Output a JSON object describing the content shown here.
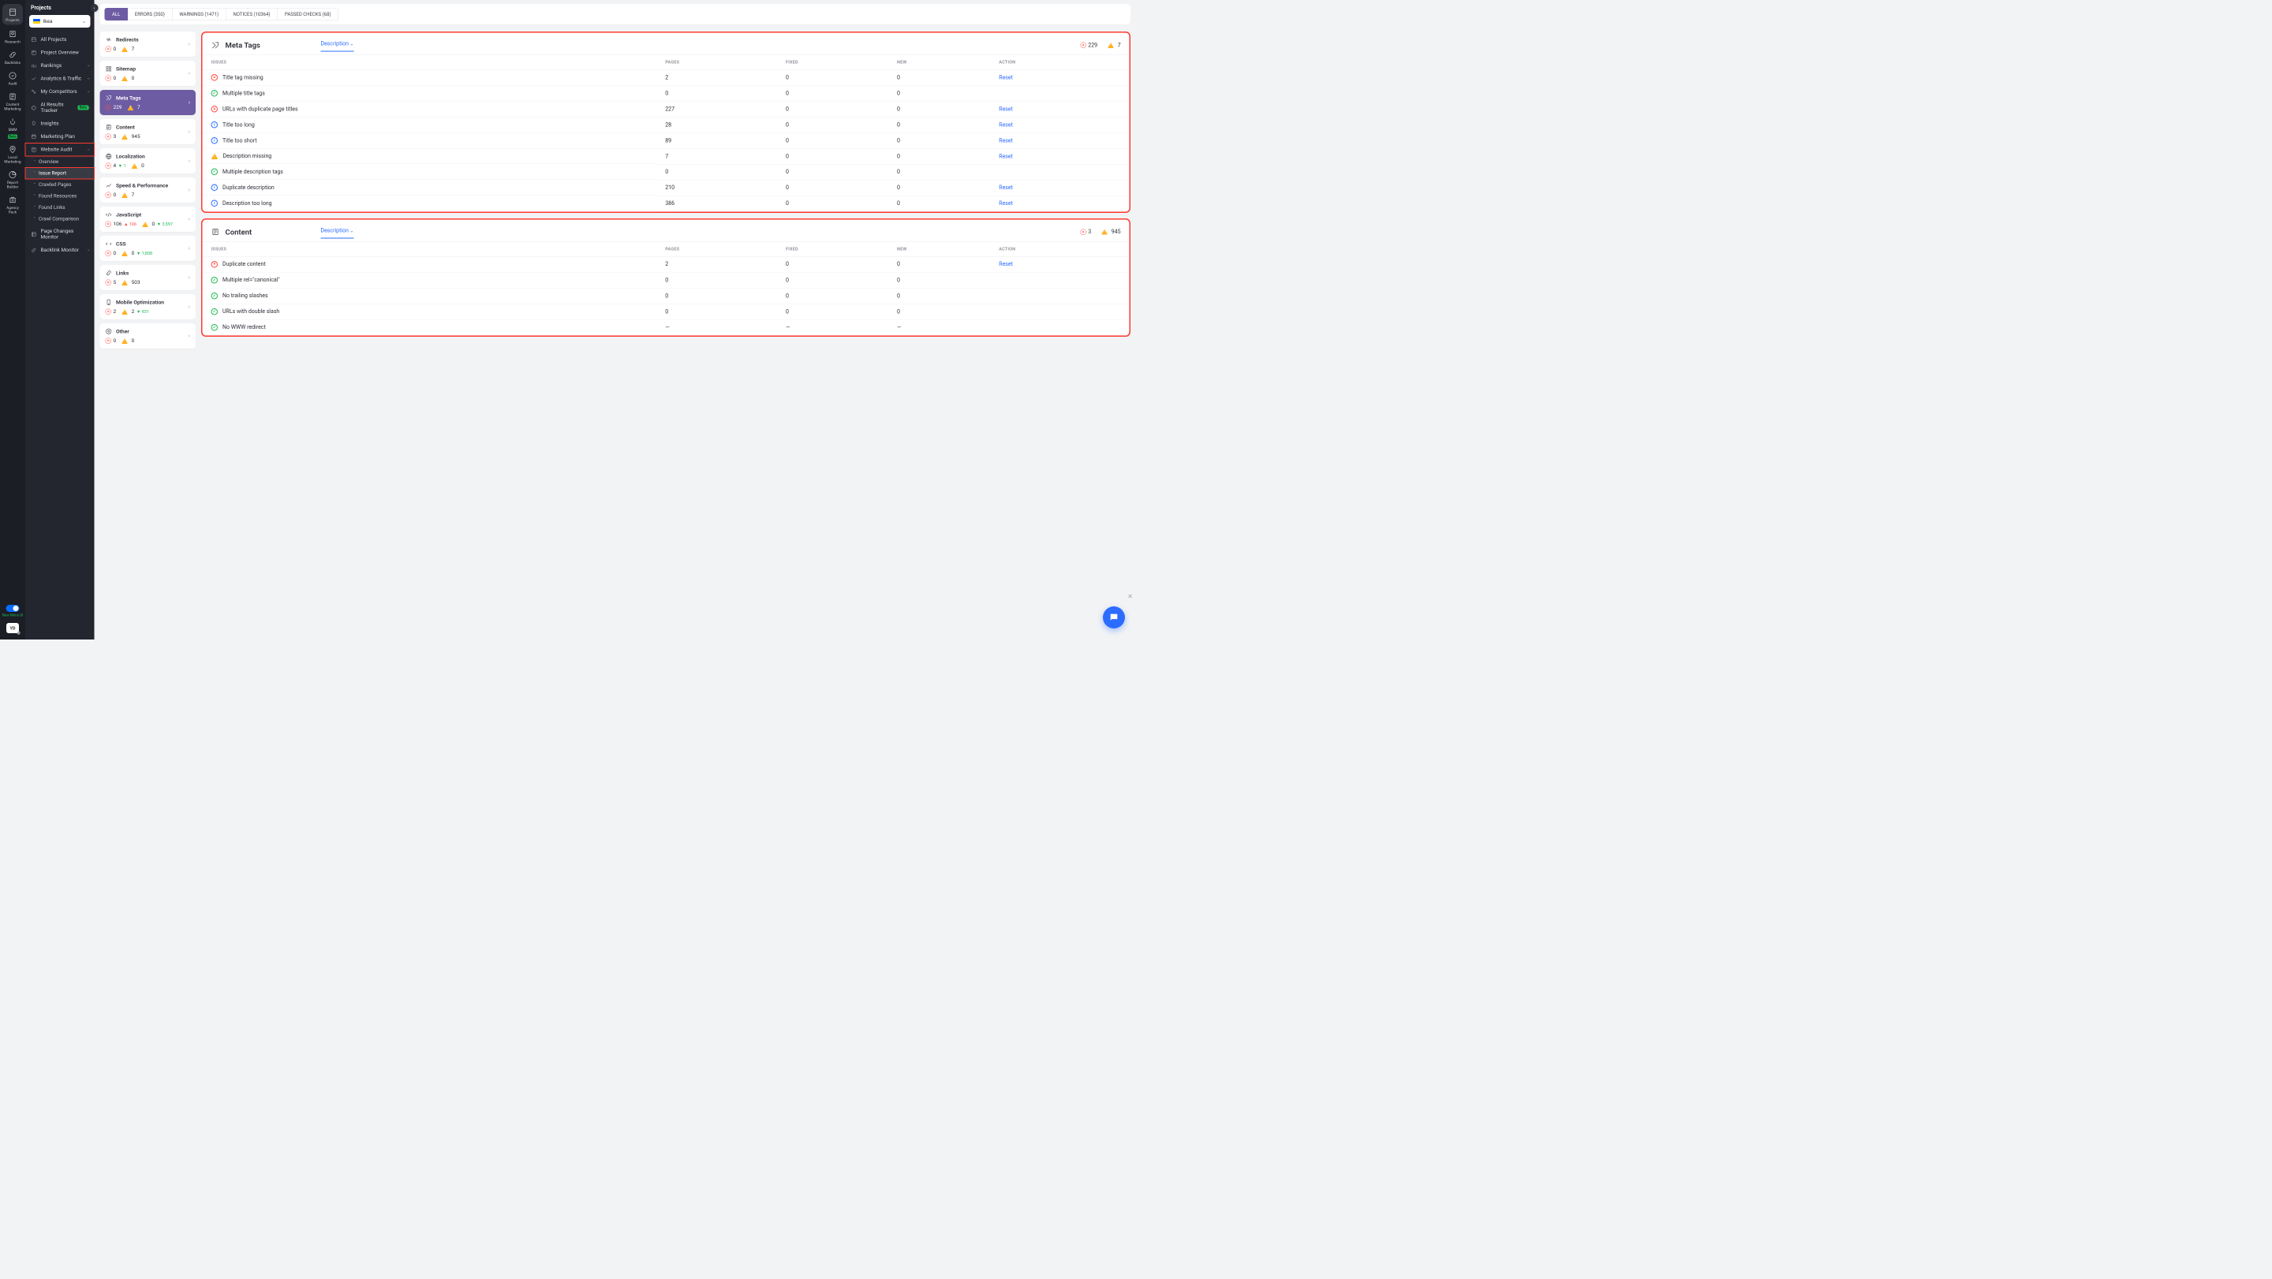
{
  "rail": [
    {
      "id": "projects",
      "label": "Projects"
    },
    {
      "id": "research",
      "label": "Research"
    },
    {
      "id": "backlinks",
      "label": "Backlinks"
    },
    {
      "id": "audit",
      "label": "Audit"
    },
    {
      "id": "content",
      "label": "Content\nMarketing"
    },
    {
      "id": "smm",
      "label": "SMM",
      "beta": true
    },
    {
      "id": "local",
      "label": "Local\nMarketing"
    },
    {
      "id": "report",
      "label": "Report\nBuilder"
    },
    {
      "id": "agency",
      "label": "Agency\nPack"
    }
  ],
  "rail_toggle_label": "New Menu UI",
  "rail_avatar": "YD",
  "sidebar": {
    "title": "Projects",
    "project": "Ikea",
    "items": [
      {
        "label": "All Projects"
      },
      {
        "label": "Project Overview"
      },
      {
        "label": "Rankings",
        "chev": true
      },
      {
        "label": "Analytics & Traffic",
        "chev": true
      },
      {
        "label": "My Competitors",
        "chev": true
      },
      {
        "label": "AI Results Tracker",
        "chev": true,
        "beta": true
      },
      {
        "label": "Insights"
      },
      {
        "label": "Marketing Plan"
      },
      {
        "label": "Website Audit",
        "chev": true,
        "open": true,
        "hl": true,
        "subs": [
          {
            "label": "Overview"
          },
          {
            "label": "Issue Report",
            "active": true,
            "hl": true
          },
          {
            "label": "Crawled Pages"
          },
          {
            "label": "Found Resources"
          },
          {
            "label": "Found Links"
          },
          {
            "label": "Crawl Comparison"
          }
        ]
      },
      {
        "label": "Page Changes Monitor"
      },
      {
        "label": "Backlink Monitor",
        "chev": true
      }
    ]
  },
  "filters": [
    {
      "label": "ALL",
      "active": true
    },
    {
      "label": "ERRORS (350)"
    },
    {
      "label": "WARNINGS (1471)"
    },
    {
      "label": "NOTICES (10364)"
    },
    {
      "label": "PASSED CHECKS (68)"
    }
  ],
  "categories": [
    {
      "id": "redirects",
      "label": "Redirects",
      "err": "0",
      "warn": "7"
    },
    {
      "id": "sitemap",
      "label": "Sitemap",
      "err": "0",
      "warn": "0"
    },
    {
      "id": "metatags",
      "label": "Meta Tags",
      "err": "229",
      "warn": "7",
      "active": true
    },
    {
      "id": "content",
      "label": "Content",
      "err": "3",
      "warn": "945"
    },
    {
      "id": "localization",
      "label": "Localization",
      "err": "4",
      "err_delta": "▼ 1",
      "warn": "0"
    },
    {
      "id": "speed",
      "label": "Speed & Performance",
      "err": "0",
      "warn": "7"
    },
    {
      "id": "javascript",
      "label": "JavaScript",
      "err": "106",
      "err_delta": "▲ 106",
      "warn": "0",
      "warn_delta": "▼ 3,597"
    },
    {
      "id": "css",
      "label": "CSS",
      "err": "0",
      "warn": "0",
      "warn_delta": "▼ 1,808"
    },
    {
      "id": "links",
      "label": "Links",
      "err": "5",
      "warn": "503"
    },
    {
      "id": "mobile",
      "label": "Mobile Optimization",
      "err": "2",
      "warn": "2",
      "warn_delta": "▼ 931"
    },
    {
      "id": "other",
      "label": "Other",
      "err": "0",
      "warn": "0"
    }
  ],
  "panels": {
    "meta": {
      "title": "Meta Tags",
      "desc_label": "Description",
      "err_total": "229",
      "warn_total": "7",
      "cols": {
        "issues": "ISSUES",
        "pages": "PAGES",
        "fixed": "FIXED",
        "new": "NEW",
        "action": "ACTION"
      },
      "rows": [
        {
          "s": "err",
          "issue": "Title tag missing",
          "pages": "2",
          "fixed": "0",
          "new": "0",
          "action": "Reset"
        },
        {
          "s": "ok",
          "issue": "Multiple title tags",
          "pages": "0",
          "fixed": "0",
          "new": "0",
          "action": ""
        },
        {
          "s": "err",
          "issue": "URLs with duplicate page titles",
          "pages": "227",
          "fixed": "0",
          "new": "0",
          "action": "Reset"
        },
        {
          "s": "info",
          "issue": "Title too long",
          "pages": "28",
          "fixed": "0",
          "new": "0",
          "action": "Reset"
        },
        {
          "s": "info",
          "issue": "Title too short",
          "pages": "89",
          "fixed": "0",
          "new": "0",
          "action": "Reset"
        },
        {
          "s": "warn",
          "issue": "Description missing",
          "pages": "7",
          "fixed": "0",
          "new": "0",
          "action": "Reset"
        },
        {
          "s": "ok",
          "issue": "Multiple description tags",
          "pages": "0",
          "fixed": "0",
          "new": "0",
          "action": ""
        },
        {
          "s": "info",
          "issue": "Duplicate description",
          "pages": "210",
          "fixed": "0",
          "new": "0",
          "action": "Reset"
        },
        {
          "s": "info",
          "issue": "Description too long",
          "pages": "386",
          "fixed": "0",
          "new": "0",
          "action": "Reset"
        }
      ]
    },
    "content": {
      "title": "Content",
      "desc_label": "Description",
      "err_total": "3",
      "warn_total": "945",
      "rows": [
        {
          "s": "err",
          "issue": "Duplicate content",
          "pages": "2",
          "fixed": "0",
          "new": "0",
          "action": "Reset"
        },
        {
          "s": "ok",
          "issue": "Multiple rel=\"canonical\"",
          "pages": "0",
          "fixed": "0",
          "new": "0",
          "action": ""
        },
        {
          "s": "ok",
          "issue": "No trailing slashes",
          "pages": "0",
          "fixed": "0",
          "new": "0",
          "action": ""
        },
        {
          "s": "ok",
          "issue": "URLs with double slash",
          "pages": "0",
          "fixed": "0",
          "new": "0",
          "action": ""
        },
        {
          "s": "ok",
          "issue": "No WWW redirect",
          "pages": "—",
          "fixed": "—",
          "new": "—",
          "action": ""
        }
      ]
    }
  }
}
